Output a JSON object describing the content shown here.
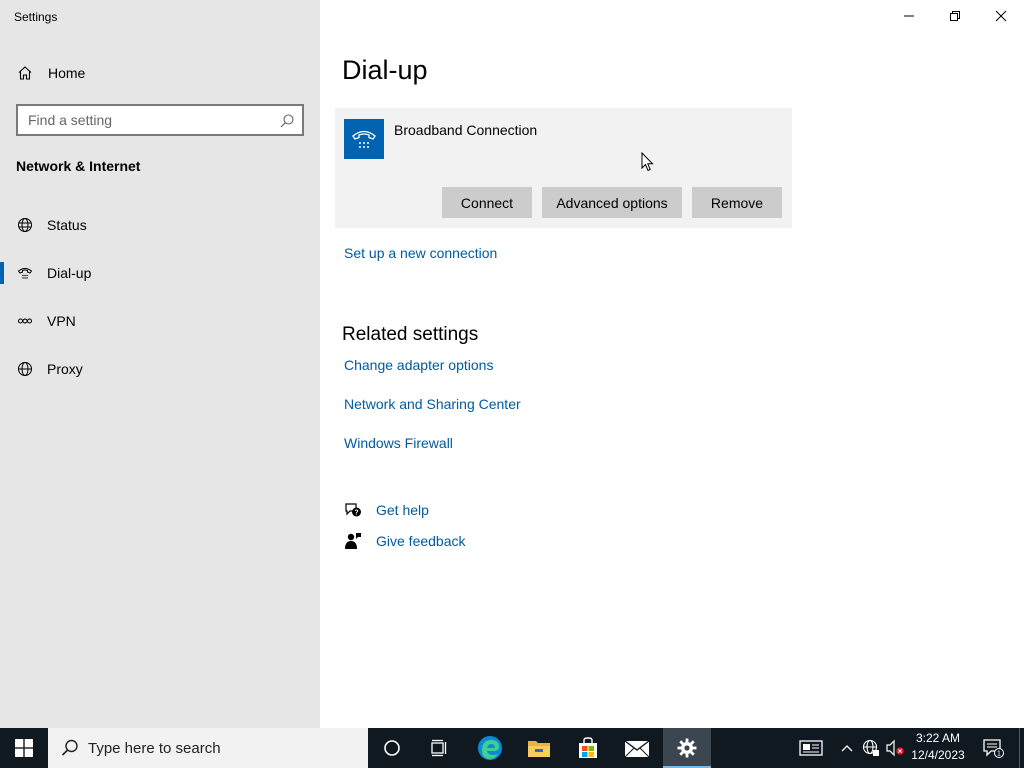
{
  "window": {
    "title": "Settings"
  },
  "sidebar": {
    "home_label": "Home",
    "search_placeholder": "Find a setting",
    "section_title": "Network & Internet",
    "items": [
      {
        "label": "Status",
        "icon": "globe-status-icon"
      },
      {
        "label": "Dial-up",
        "icon": "dialup-phone-icon",
        "selected": true
      },
      {
        "label": "VPN",
        "icon": "vpn-icon"
      },
      {
        "label": "Proxy",
        "icon": "globe-icon"
      }
    ]
  },
  "main": {
    "title": "Dial-up",
    "connection": {
      "name": "Broadband Connection",
      "icon": "telephone-icon",
      "buttons": {
        "connect": "Connect",
        "advanced": "Advanced options",
        "remove": "Remove"
      }
    },
    "setup_link": "Set up a new connection",
    "related_title": "Related settings",
    "related_links": [
      "Change adapter options",
      "Network and Sharing Center",
      "Windows Firewall"
    ],
    "help": {
      "get_help": "Get help",
      "feedback": "Give feedback"
    }
  },
  "taskbar": {
    "search_placeholder": "Type here to search",
    "clock_time": "3:22 AM",
    "clock_date": "12/4/2023",
    "notification_count": "1",
    "accent_color": "#0063b1",
    "background_color": "#101820"
  }
}
